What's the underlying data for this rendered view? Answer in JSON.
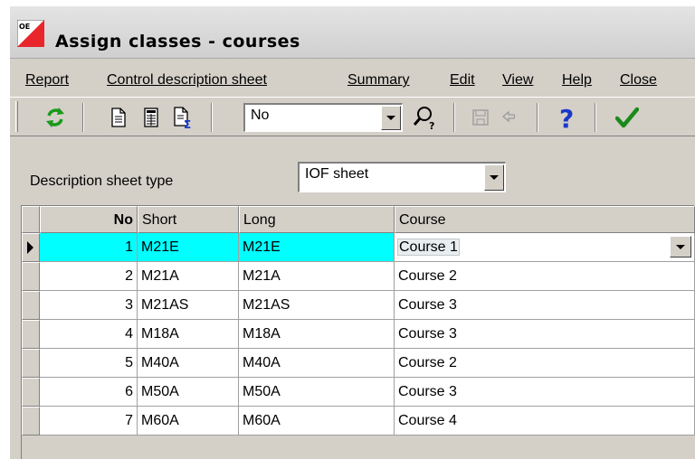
{
  "window": {
    "title": "Assign classes - courses"
  },
  "menu": [
    {
      "label": "Report",
      "underline_index": 0
    },
    {
      "label": "Control description sheet",
      "underline_index": 0
    },
    {
      "label": "Summary",
      "underline_index": 0
    },
    {
      "label": "Edit",
      "underline_index": 0
    },
    {
      "label": "View",
      "underline_index": 0
    },
    {
      "label": "Help",
      "underline_index": 0
    },
    {
      "label": "Close",
      "underline_index": 0
    }
  ],
  "toolbar": {
    "combo_value": "No",
    "icons": [
      "refresh-icon",
      "document-icon",
      "table-icon",
      "document-sum-icon",
      "find-icon",
      "save-icon",
      "undo-icon",
      "help-icon",
      "checkmark-icon"
    ],
    "colors": {
      "refresh": "#1a9a1a",
      "help": "#1b39c8",
      "check": "#1a8a1a"
    }
  },
  "description_sheet": {
    "label": "Description sheet type",
    "value": "IOF sheet"
  },
  "grid": {
    "columns": [
      "No",
      "Short",
      "Long",
      "Course"
    ],
    "selection_color": "#00ffff",
    "rows": [
      {
        "no": "1",
        "short": "M21E",
        "long": "M21E",
        "course": "Course 1"
      },
      {
        "no": "2",
        "short": "M21A",
        "long": "M21A",
        "course": "Course 2"
      },
      {
        "no": "3",
        "short": "M21AS",
        "long": "M21AS",
        "course": "Course 3"
      },
      {
        "no": "4",
        "short": "M18A",
        "long": "M18A",
        "course": "Course 3"
      },
      {
        "no": "5",
        "short": "M40A",
        "long": "M40A",
        "course": "Course 2"
      },
      {
        "no": "6",
        "short": "M50A",
        "long": "M50A",
        "course": "Course 3"
      },
      {
        "no": "7",
        "short": "M60A",
        "long": "M60A",
        "course": "Course 4"
      }
    ]
  }
}
